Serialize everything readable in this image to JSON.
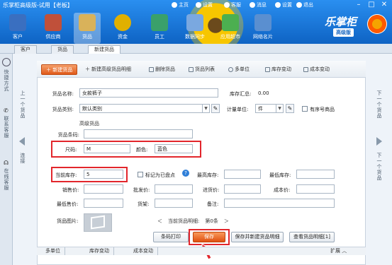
{
  "app": {
    "title": "乐掌柜高级版-试用【老板】",
    "top_links": [
      "主页",
      "设置",
      "客服",
      "消息",
      "设置",
      "退出"
    ],
    "window_buttons": [
      "–",
      "□",
      "✕"
    ],
    "brand": "乐掌柜",
    "edition": "高级版"
  },
  "toolbar": [
    {
      "label": "客户",
      "icon": "customer-icon",
      "color": "#3a6fc0"
    },
    {
      "label": "供应商",
      "icon": "supplier-icon",
      "color": "#c0503a"
    },
    {
      "label": "货品",
      "icon": "goods-icon",
      "color": "#d9b25a"
    },
    {
      "label": "资金",
      "icon": "money-icon",
      "color": "#e0b000"
    },
    {
      "label": "员工",
      "icon": "staff-icon",
      "color": "#3aa06a"
    },
    {
      "label": "数据同步",
      "icon": "sync-icon",
      "color": "#7aa8e0"
    },
    {
      "label": "应用超市",
      "icon": "shop-icon",
      "color": "#4caf50"
    },
    {
      "label": "网络名片",
      "icon": "card-icon",
      "color": "#5a8fd0"
    }
  ],
  "tabs": [
    "客户",
    "货品",
    "新建货品"
  ],
  "left_sidebar": {
    "quick": "快捷方式",
    "contact": "联系客服",
    "online": "在线客服"
  },
  "nav": {
    "prev": "上一个货品",
    "next": "下一个货品",
    "connect": "连接"
  },
  "action_bar": {
    "new_goods": "新建货品",
    "new_advanced": "新建高级货品明细",
    "delete": "删除货品",
    "list": "货品列表",
    "multi_unit": "多单位",
    "stock_change": "库存变动",
    "cost_change": "成本变动"
  },
  "form": {
    "name_label": "货品名称:",
    "name_value": "女款裤子",
    "stock_label": "库存汇总:",
    "stock_value": "0.00",
    "category_label": "货品类别:",
    "category_value": "默认类别",
    "unit_label": "计量单位:",
    "unit_value": "件",
    "serial_label": "有序号商品",
    "advanced_title": "高级货品",
    "barcode_label": "货品条码:",
    "barcode_value": "",
    "size_label": "尺码:",
    "size_value": "M",
    "color_label": "颜色:",
    "color_value": "蓝色",
    "current_stock_label": "当前库存:",
    "current_stock_value": "5",
    "mark_counted_label": "标记为已盘点",
    "max_stock_label": "最高库存:",
    "min_stock_label": "最低库存:",
    "sale_price_label": "销售价:",
    "wholesale_label": "批发价:",
    "purchase_label": "进货价:",
    "cost_label": "成本价:",
    "min_price_label": "最低售价:",
    "shelf_label": "货架:",
    "note_label": "备注:",
    "photo_label": "货品图片:",
    "current_detail_label": "当前货品明细:",
    "current_detail_value": "第0条"
  },
  "buttons": {
    "barcode_print": "条码打印",
    "save": "保存",
    "save_new": "保存并新建货品明细",
    "view_detail": "查看货品明细[1]"
  },
  "bottom_tabs": [
    "多单位",
    "库存变动",
    "成本变动"
  ],
  "expand": "扩展",
  "colors": {
    "topbar": "#1e7ee0",
    "accent_orange": "#e05a1a",
    "highlight_red": "#e2262c"
  }
}
